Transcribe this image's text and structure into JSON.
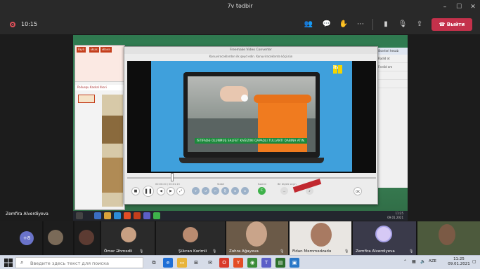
{
  "window": {
    "title": "7v tədbir"
  },
  "meeting": {
    "timer": "10:15",
    "leave_label": "Выйти",
    "toolbar_icons": [
      "participants-icon",
      "chat-icon",
      "raise-hand-icon",
      "more-icon",
      "camera-icon",
      "mic-icon",
      "share-icon",
      "phone-icon"
    ]
  },
  "shared": {
    "converter_title": "Freemake Video Converter",
    "converter_subtitle": "Konuvirəcəklərdən ilk qeyd edin. Konuvirəcəklərdə köçürün",
    "video_caption": "İSTİFADƏ OLUNMUŞ SALFET KAĞIZINI QAPAQLI TULLANTI QABINA ATIN.",
    "channel_logo": "itv",
    "time_readout": "00:00:20 / 00:01:15",
    "tiny_labels": [
      "Stabil",
      "Kəsinti",
      "Hamısı",
      "Bir ölçülü seçin"
    ],
    "ok_label": "OK",
    "ppt_tabs": [
      "Faylı",
      "Əsas",
      "Əlavə"
    ],
    "ppt_title": "Pollusqu Kaskal Ilkori",
    "right_panel_head": "Əsərləri hesab",
    "right_panel_rows": [
      "Radid ət",
      "Fərdid əm",
      "",
      ""
    ],
    "shared_clock_time": "11:25",
    "shared_clock_date": "09.01.2021",
    "presenter": "Zemfira Alverdiyeva"
  },
  "participants": {
    "overflow": "+8",
    "people": [
      {
        "name": "Ömər Əhmədli"
      },
      {
        "name": "Şükran Kərimli"
      },
      {
        "name": "Zəhra Ağayeva"
      },
      {
        "name": "Fidan Məmmədzadə"
      },
      {
        "name": "Zemfira Alverdiyeva"
      }
    ]
  },
  "taskbar": {
    "search_placeholder": "Введите здесь текст для поиска",
    "lang": "AZE",
    "time": "11:25",
    "date": "09.01.2021"
  },
  "colors": {
    "leave": "#c4314b",
    "toolbar": "#292929",
    "accent_orange": "#f07b1f",
    "caption_green": "#1c8a3c"
  }
}
